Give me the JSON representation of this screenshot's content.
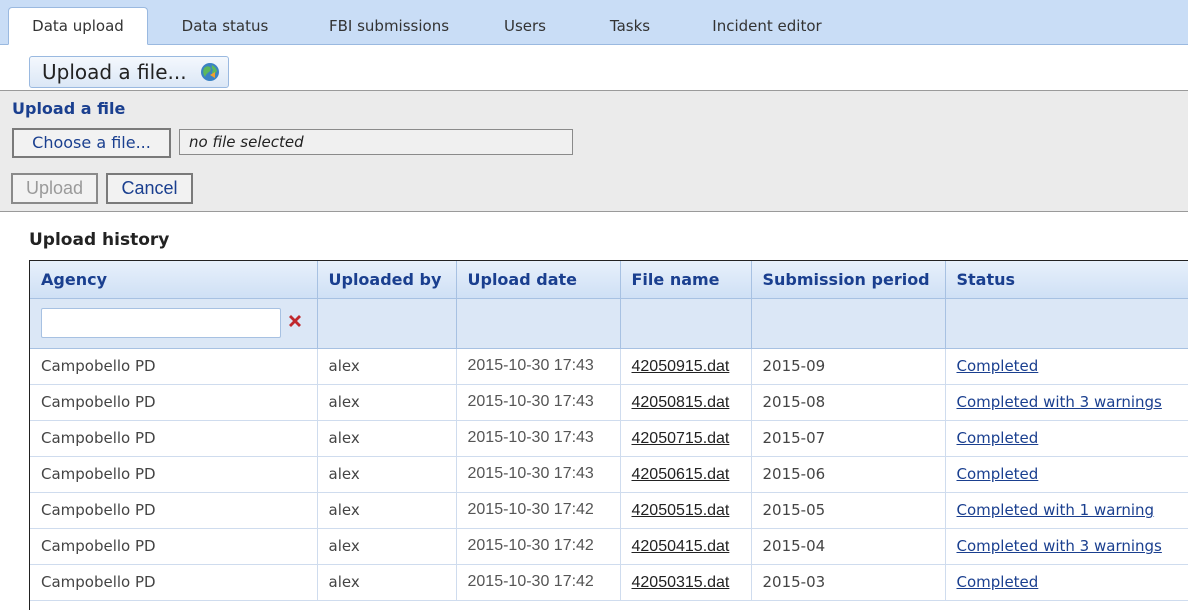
{
  "tabs": [
    {
      "label": "Data upload",
      "active": true
    },
    {
      "label": "Data status"
    },
    {
      "label": "FBI submissions"
    },
    {
      "label": "Users"
    },
    {
      "label": "Tasks"
    },
    {
      "label": "Incident editor"
    }
  ],
  "upload_toggle": {
    "label": "Upload a file...",
    "icon": "globe-icon"
  },
  "upload_panel": {
    "title": "Upload a file",
    "choose_label": "Choose a file...",
    "file_value": "no file selected",
    "upload_label": "Upload",
    "cancel_label": "Cancel"
  },
  "history": {
    "title": "Upload history",
    "columns": [
      "Agency",
      "Uploaded by",
      "Upload date",
      "File name",
      "Submission period",
      "Status"
    ],
    "filter": {
      "agency_value": "",
      "clear_icon": "clear-x-icon"
    },
    "rows": [
      {
        "agency": "Campobello PD",
        "user": "alex",
        "date": "2015-10-30 17:43",
        "file": "42050915.dat",
        "period": "2015-09",
        "status": "Completed"
      },
      {
        "agency": "Campobello PD",
        "user": "alex",
        "date": "2015-10-30 17:43",
        "file": "42050815.dat",
        "period": "2015-08",
        "status": "Completed with 3 warnings"
      },
      {
        "agency": "Campobello PD",
        "user": "alex",
        "date": "2015-10-30 17:43",
        "file": "42050715.dat",
        "period": "2015-07",
        "status": "Completed"
      },
      {
        "agency": "Campobello PD",
        "user": "alex",
        "date": "2015-10-30 17:43",
        "file": "42050615.dat",
        "period": "2015-06",
        "status": "Completed"
      },
      {
        "agency": "Campobello PD",
        "user": "alex",
        "date": "2015-10-30 17:42",
        "file": "42050515.dat",
        "period": "2015-05",
        "status": "Completed with 1 warning"
      },
      {
        "agency": "Campobello PD",
        "user": "alex",
        "date": "2015-10-30 17:42",
        "file": "42050415.dat",
        "period": "2015-04",
        "status": "Completed with 3 warnings"
      },
      {
        "agency": "Campobello PD",
        "user": "alex",
        "date": "2015-10-30 17:42",
        "file": "42050315.dat",
        "period": "2015-03",
        "status": "Completed"
      }
    ]
  },
  "colors": {
    "tab_bar": "#c9ddf6",
    "link": "#1a3f8f",
    "panel": "#ebebeb",
    "clear_icon": "#c0282d"
  }
}
